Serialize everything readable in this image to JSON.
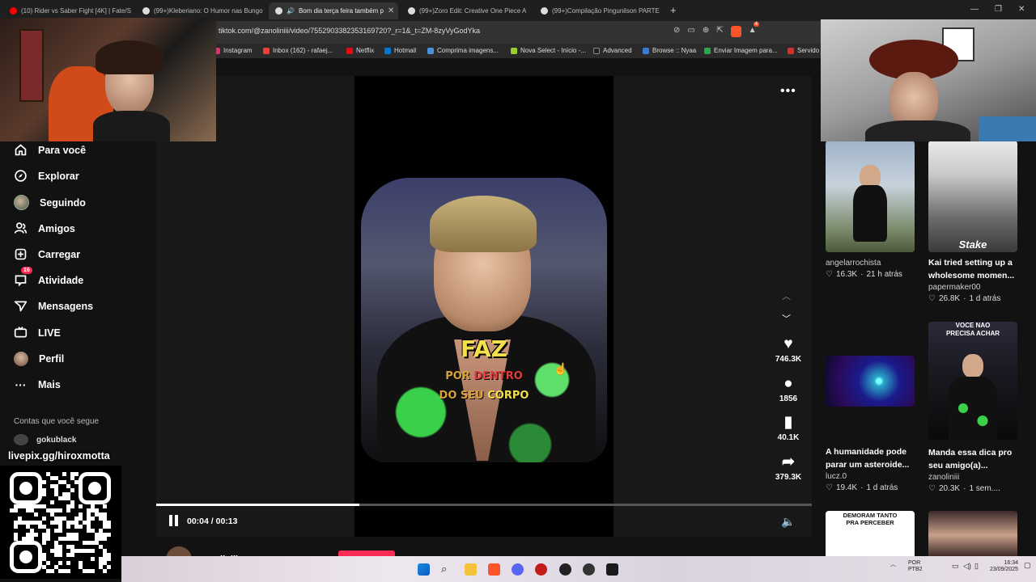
{
  "browser": {
    "tabs": [
      {
        "title": "(10) Rider vs Saber Fight [4K] | Fate/S"
      },
      {
        "title": "(99+)Kleberiano: O Humor nas Bungo"
      },
      {
        "title": "Bom dia terça feira também p"
      },
      {
        "title": "(99+)Zoro Edit: Creative One Piece A"
      },
      {
        "title": "(99+)Compilação Pingunilson PARTE"
      }
    ],
    "new_tab": "+",
    "url": "tiktok.com/@zanoliniii/video/7552903382353169720?_r=1&_t=ZM-8zyVyGodYka",
    "notification_count": "4",
    "bookmarks": [
      {
        "label": "Instagram",
        "color": "#e1306c"
      },
      {
        "label": "Inbox (162) - rafaej...",
        "color": "#ea4335"
      },
      {
        "label": "Netflix",
        "color": "#e50914"
      },
      {
        "label": "Hotmail",
        "color": "#0078d4"
      },
      {
        "label": "Comprima imagens...",
        "color": "#4a90d9"
      },
      {
        "label": "Nova Select - Início -...",
        "color": "#9acd32"
      },
      {
        "label": "Advanced",
        "color": "#222222"
      },
      {
        "label": "Browse :: Nyaa",
        "color": "#3a7bd5"
      },
      {
        "label": "Enviar Imagem para...",
        "color": "#2ea44f"
      },
      {
        "label": "Servido",
        "color": "#cc3333"
      }
    ]
  },
  "sidebar": {
    "items": [
      {
        "label": "Para você",
        "icon": "home-icon"
      },
      {
        "label": "Explorar",
        "icon": "compass-icon"
      },
      {
        "label": "Seguindo",
        "icon": "avatar"
      },
      {
        "label": "Amigos",
        "icon": "friends-icon"
      },
      {
        "label": "Carregar",
        "icon": "upload-icon"
      },
      {
        "label": "Atividade",
        "icon": "inbox-icon",
        "badge": "16"
      },
      {
        "label": "Mensagens",
        "icon": "send-icon"
      },
      {
        "label": "LIVE",
        "icon": "live-icon"
      },
      {
        "label": "Perfil",
        "icon": "profile-avatar"
      },
      {
        "label": "Mais",
        "icon": "more-icon"
      }
    ],
    "following_title": "Contas que você segue",
    "following": [
      {
        "name": "gokublack"
      }
    ]
  },
  "overlay": {
    "livepix": "livepix.gg/hiroxmotta"
  },
  "video": {
    "captions": {
      "line1": "FAZ",
      "line2a": "POR ",
      "line2b": "DENTRO",
      "line3a": "DO SEU ",
      "line3b": "CORPO"
    },
    "likes": "746.3K",
    "comments": "1856",
    "saves": "40.1K",
    "shares": "379.3K",
    "time": "00:04 / 00:13",
    "progress": 0.31,
    "creator": "zanoliniii"
  },
  "suggestions": [
    {
      "title": "",
      "user": "angelarrochista",
      "likes": "16.3K",
      "age": "21 h atrás",
      "thumb_text": ""
    },
    {
      "title": "Kai tried setting up a wholesome momen...",
      "user": "papermaker00",
      "likes": "26.8K",
      "age": "1 d atrás",
      "thumb_text": "Stake"
    },
    {
      "title": "A humanidade pode parar um asteroide...",
      "user": "lucz.0",
      "likes": "19.4K",
      "age": "1 d atrás",
      "thumb_text": ""
    },
    {
      "title": "Manda essa dica pro seu amigo(a)...",
      "user": "zanoliniii",
      "likes": "20.3K",
      "age": "1 sem....",
      "thumb_text": "VOCE NAO PRECISA ACHAR"
    },
    {
      "thumb_text": "DEMORAM TANTO PRA PERCEBER"
    },
    {
      "thumb_text": ""
    }
  ],
  "taskbar": {
    "lang_line1": "POR",
    "lang_line2": "PTB2",
    "clock": "16:34",
    "date": "23/09/2025"
  },
  "colors": {
    "accent": "#fe2c55",
    "background": "#121212"
  }
}
